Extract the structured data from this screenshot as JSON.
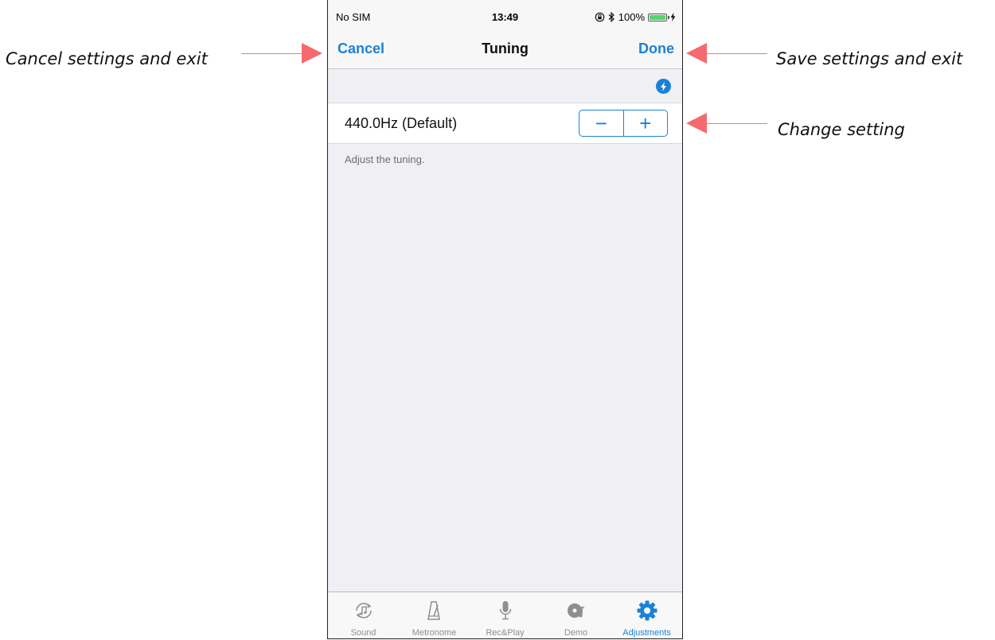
{
  "status_bar": {
    "carrier": "No SIM",
    "time": "13:49",
    "battery": "100%"
  },
  "nav": {
    "cancel": "Cancel",
    "title": "Tuning",
    "done": "Done"
  },
  "setting": {
    "value": "440.0Hz (Default)",
    "minus": "−",
    "plus": "+",
    "footnote": "Adjust the tuning."
  },
  "tabs": [
    {
      "label": "Sound",
      "icon": "sound-icon",
      "active": false
    },
    {
      "label": "Metronome",
      "icon": "metronome-icon",
      "active": false
    },
    {
      "label": "Rec&Play",
      "icon": "microphone-icon",
      "active": false
    },
    {
      "label": "Demo",
      "icon": "disc-icon",
      "active": false
    },
    {
      "label": "Adjustments",
      "icon": "gear-icon",
      "active": true
    }
  ],
  "annotations": {
    "cancel": "Cancel settings and exit",
    "save": "Save settings and exit",
    "change": "Change setting"
  },
  "colors": {
    "accent": "#1a82d6",
    "arrow": "#f46a6f",
    "background": "#efeff4"
  }
}
